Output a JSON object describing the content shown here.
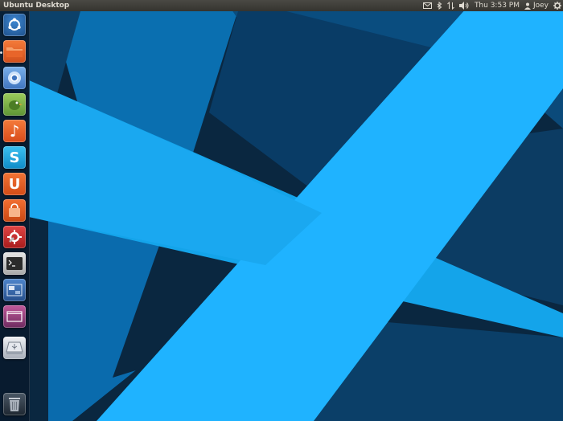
{
  "panel": {
    "title": "Ubuntu Desktop",
    "clock": "Thu  3:53 PM",
    "user": "Joey",
    "indicators": [
      "mail-icon",
      "bluetooth-icon",
      "network-icon",
      "volume-icon",
      "session-gear-icon"
    ]
  },
  "launcher": {
    "items": [
      {
        "name": "dash-home",
        "icon": "ubuntu-logo-icon",
        "color": "#2f6fb0"
      },
      {
        "name": "files",
        "icon": "folder-icon",
        "color": "#e8652a"
      },
      {
        "name": "chromium",
        "icon": "chromium-icon",
        "color": "#5b8fd0"
      },
      {
        "name": "pidgin",
        "icon": "pidgin-icon",
        "color": "#7fb24a"
      },
      {
        "name": "rhythmbox",
        "icon": "music-note-icon",
        "color": "#e8632b",
        "glyph": "♪"
      },
      {
        "name": "skype",
        "icon": "skype-icon",
        "color": "#1ea9e1",
        "glyph": "S"
      },
      {
        "name": "ubuntu-one",
        "icon": "ubuntu-one-icon",
        "color": "#e55f22",
        "glyph": "U"
      },
      {
        "name": "software-center",
        "icon": "shopping-bag-icon",
        "color": "#e25a1f"
      },
      {
        "name": "system-settings",
        "icon": "settings-icon",
        "color": "#c92a2a"
      },
      {
        "name": "terminal",
        "icon": "terminal-icon",
        "color": "#d9d9d9"
      },
      {
        "name": "workspace-switcher",
        "icon": "workspace-icon",
        "color": "#3a6db0"
      },
      {
        "name": "show-desktop",
        "icon": "desktop-icon",
        "color": "#b24a8e"
      },
      {
        "name": "usb-drive",
        "icon": "usb-drive-icon",
        "color": "#c8ced6"
      },
      {
        "name": "trash",
        "icon": "trash-icon",
        "color": "#8a9099"
      }
    ]
  },
  "colors": {
    "panel": "#3c3b37",
    "wallpaper_dark": "#0b2b45",
    "wallpaper_mid": "#004a78",
    "wallpaper_bright": "#1fa8e6",
    "wallpaper_cyan": "#23b6ff"
  }
}
